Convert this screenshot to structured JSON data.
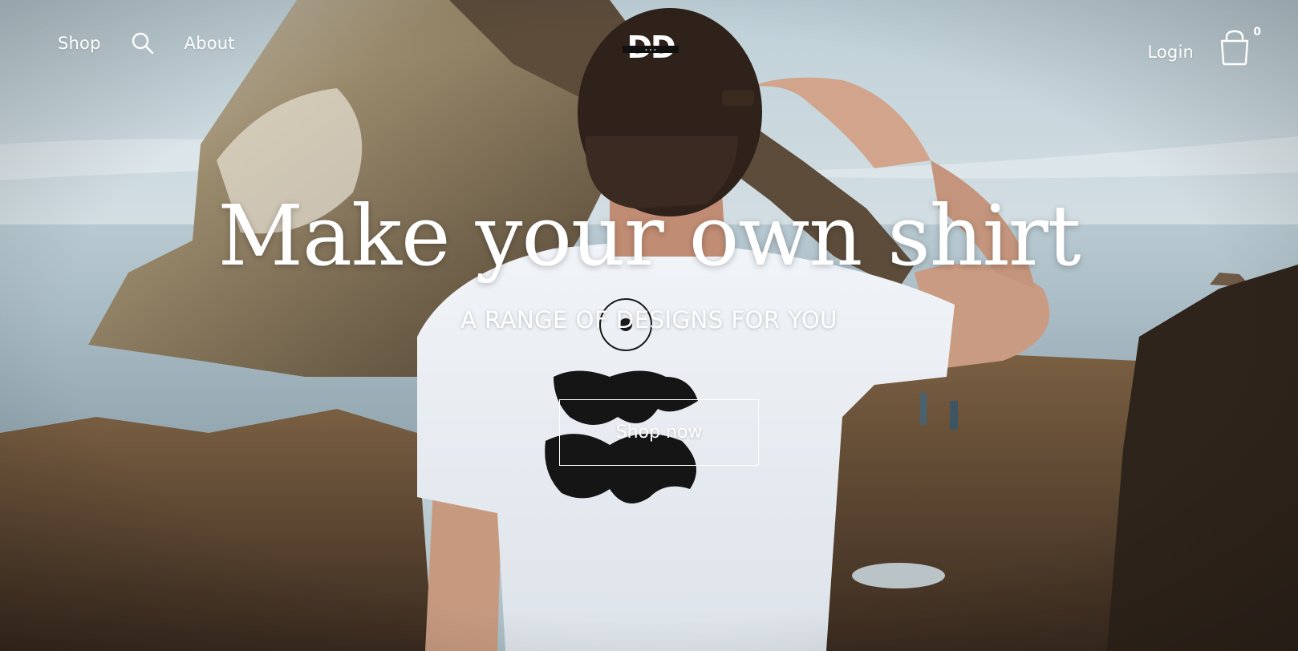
{
  "nav": {
    "shop_label": "Shop",
    "about_label": "About",
    "login_label": "Login",
    "cart_count": "0",
    "search_icon": "search-icon",
    "cart_icon": "shopping-bag-icon"
  },
  "logo": {
    "letters": "DD",
    "icon": "brand-logo-icon"
  },
  "hero": {
    "headline": "Make your own shirt",
    "subheadline": "A RANGE OF DESIGNS FOR YOU",
    "cta_label": "Shop now"
  },
  "colors": {
    "text": "#ffffff",
    "sky": "#cfdbe0",
    "rock": "#6b5a45",
    "shirt": "#e9eef3"
  }
}
